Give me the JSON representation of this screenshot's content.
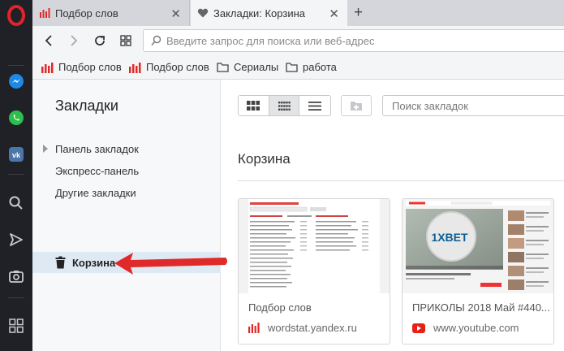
{
  "tabs": [
    {
      "title": "Подбор слов",
      "close": "✕"
    },
    {
      "title": "Закладки: Корзина",
      "close": "✕"
    }
  ],
  "new_tab": "+",
  "address": {
    "placeholder": "Введите запрос для поиска или веб-адрес"
  },
  "bookmarks_bar": [
    {
      "label": "Подбор слов",
      "icon": "yandex-wordstat-icon"
    },
    {
      "label": "Подбор слов",
      "icon": "yandex-wordstat-icon"
    },
    {
      "label": "Сериалы",
      "icon": "folder-icon"
    },
    {
      "label": "работа",
      "icon": "folder-icon"
    }
  ],
  "left_pane": {
    "title": "Закладки",
    "items": [
      "Панель закладок",
      "Экспресс-панель",
      "Другие закладки"
    ],
    "trash": "Корзина"
  },
  "main": {
    "search_placeholder": "Поиск закладок",
    "section_title": "Корзина",
    "cards": [
      {
        "title": "Подбор слов",
        "url": "wordstat.yandex.ru"
      },
      {
        "title": "ПРИКОЛЫ 2018 Май #440...",
        "url": "www.youtube.com"
      }
    ]
  },
  "colors": {
    "accent_red": "#e2232d",
    "arrow_red": "#e02a2a",
    "sidebar_bg": "#1f2126"
  }
}
